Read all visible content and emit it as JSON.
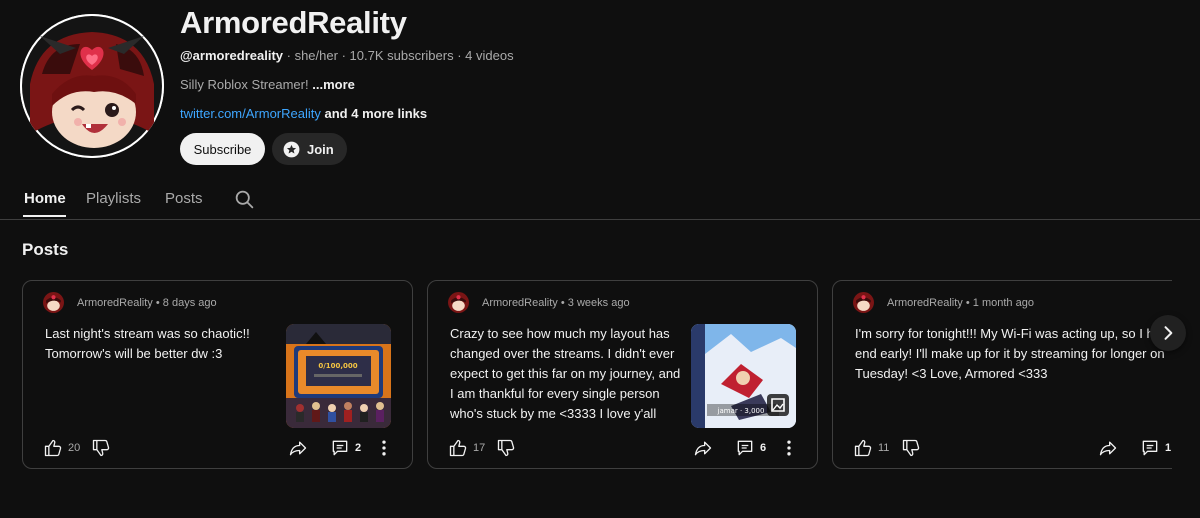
{
  "channel": {
    "name": "ArmoredReality",
    "handle": "@armoredreality",
    "pronouns": "she/her",
    "subscribers": "10.7K subscribers",
    "videos": "4 videos",
    "description": "Silly Roblox Streamer!",
    "more_label": "...more",
    "link": "twitter.com/ArmorReality",
    "more_links": "and 4 more links",
    "subscribe_label": "Subscribe",
    "join_label": "Join"
  },
  "tabs": [
    {
      "label": "Home",
      "active": true
    },
    {
      "label": "Playlists",
      "active": false
    },
    {
      "label": "Posts",
      "active": false
    }
  ],
  "section_title": "Posts",
  "posts": [
    {
      "author": "ArmoredReality",
      "time": "8 days ago",
      "text": "Last night's stream was so chaotic!! Tomorrow's will be better dw :3",
      "likes": "20",
      "comments": "2",
      "has_thumb": true
    },
    {
      "author": "ArmoredReality",
      "time": "3 weeks ago",
      "text": "Crazy to see how much my layout has changed over the streams. I didn't ever expect to get this far on my journey, and I am thankful for every single person who's stuck by me <3333 I love y'all so...",
      "likes": "17",
      "comments": "6",
      "has_thumb": true
    },
    {
      "author": "ArmoredReality",
      "time": "1 month ago",
      "text": "I'm sorry for tonight!!! My Wi-Fi was acting up, so I had to end early! I'll make up for it by streaming for longer on Tuesday! <3 Love, Armored <333",
      "likes": "11",
      "comments": "1",
      "has_thumb": false
    }
  ],
  "colors": {
    "background": "#0f0f0f",
    "link": "#3ea6ff",
    "card_border": "#3f3f3f"
  }
}
